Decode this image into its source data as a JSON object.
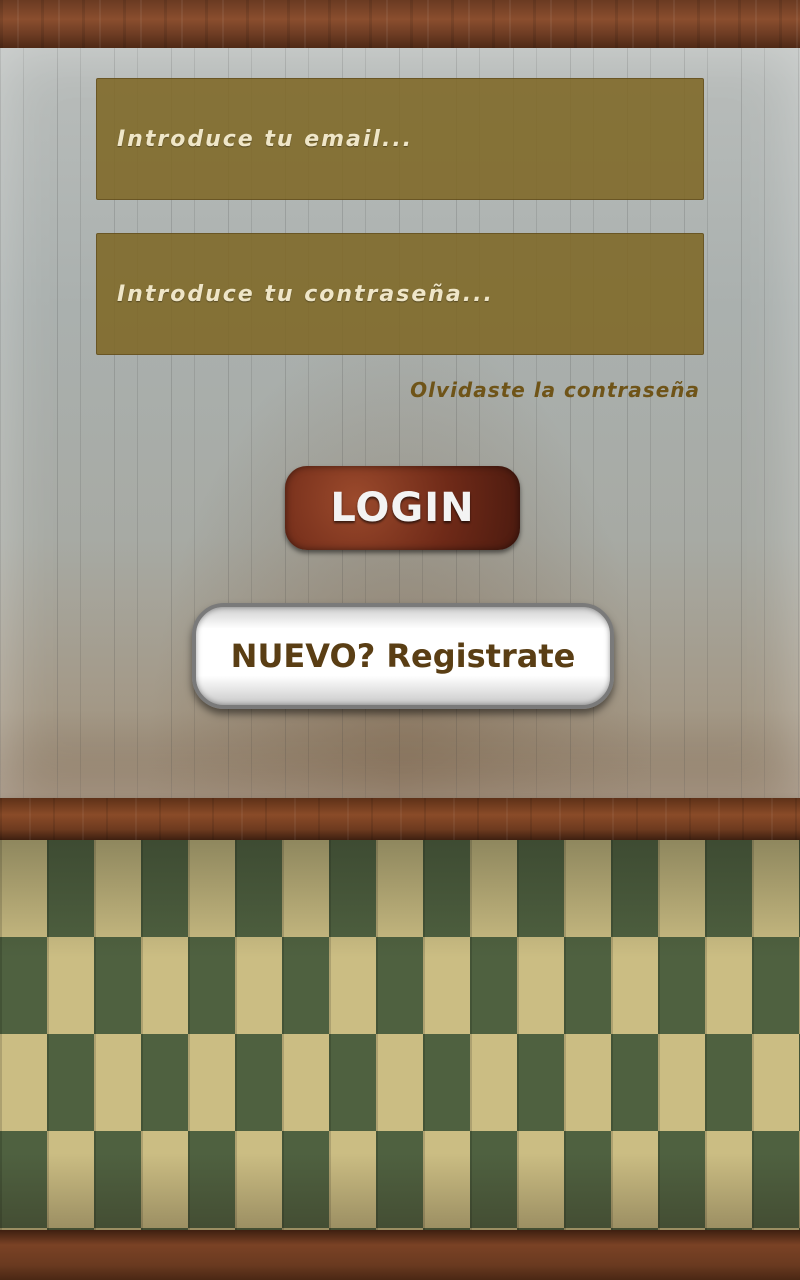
{
  "login_form": {
    "email_placeholder": "Introduce tu email...",
    "password_placeholder": "Introduce tu contraseña...",
    "forgot_password_label": "Olvidaste la contraseña",
    "login_button_label": "LOGIN",
    "register_button_label": "NUEVO? Registrate"
  },
  "theme": {
    "input_background": "#7e6826",
    "input_text": "#efe6c8",
    "forgot_link": "#6f5418",
    "login_button": "#6f2a18",
    "register_text": "#5a3e14",
    "floor_dark_tile": "#4f6140",
    "floor_light_tile": "#cbbd83"
  }
}
